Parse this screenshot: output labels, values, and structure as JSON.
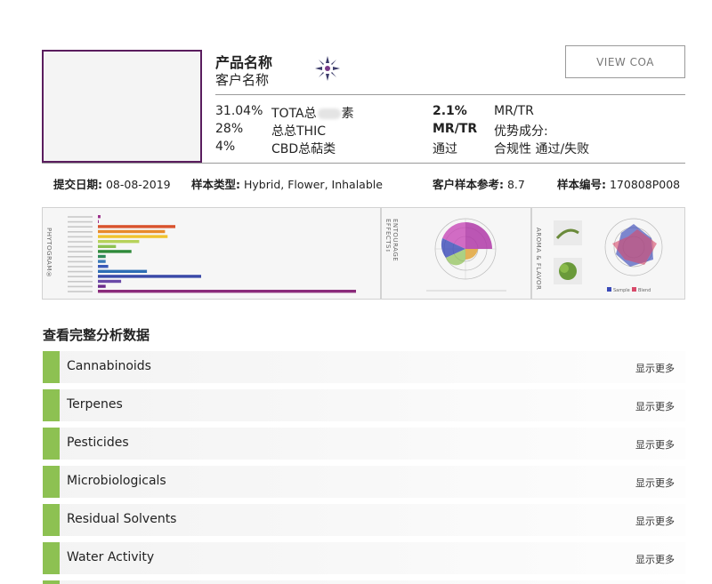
{
  "product": {
    "name": "产品名称",
    "customer": "客户名称",
    "view_coa": "VIEW COA"
  },
  "stats": {
    "left": [
      {
        "value": "31.04%",
        "label_a": "TOTA总",
        "label_b": "素"
      },
      {
        "value": "28%",
        "label": "总总THIC"
      },
      {
        "value": "4%",
        "label": "CBD总萜类"
      }
    ],
    "right": [
      {
        "key": "2.1%",
        "value": "MR/TR"
      },
      {
        "key": "MR/TR",
        "value": "优势成分:"
      },
      {
        "key": "通过",
        "value": "合规性 通过/失败"
      }
    ]
  },
  "meta": {
    "date_key": "提交日期:",
    "date_val": "08-08-2019",
    "type_key": "样本类型:",
    "type_val": "Hybrid, Flower, Inhalable",
    "ref_key": "客户样本参考:",
    "ref_val": "8.7",
    "id_key": "样本编号:",
    "id_val": "170808P008"
  },
  "panels": {
    "p1_label": "PHYTOGRAM®",
    "p2_label": "ENTOURAGE EFFECTS™",
    "p3_label": "AROMA & FLAVOR",
    "p3_legend_a": "Sample",
    "p3_legend_b": "Blend",
    "p1_bars": [
      {
        "frac": 0.01,
        "color": "#9b2f8a"
      },
      {
        "frac": 0.0,
        "color": "#9b2f8a"
      },
      {
        "frac": 0.3,
        "color": "#d9522c"
      },
      {
        "frac": 0.26,
        "color": "#e88a2c"
      },
      {
        "frac": 0.27,
        "color": "#f0c32e"
      },
      {
        "frac": 0.16,
        "color": "#b7d25a"
      },
      {
        "frac": 0.07,
        "color": "#8dc152"
      },
      {
        "frac": 0.13,
        "color": "#2f8a3a"
      },
      {
        "frac": 0.03,
        "color": "#2f8a5a"
      },
      {
        "frac": 0.03,
        "color": "#3a7ab8"
      },
      {
        "frac": 0.04,
        "color": "#3a5ab8"
      },
      {
        "frac": 0.19,
        "color": "#2e6eb5"
      },
      {
        "frac": 0.4,
        "color": "#3a4aa8"
      },
      {
        "frac": 0.09,
        "color": "#6a4aa8"
      },
      {
        "frac": 0.03,
        "color": "#6a2a8a"
      },
      {
        "frac": 1.0,
        "color": "#8a2a7a"
      }
    ]
  },
  "analysis": {
    "title": "查看完整分析数据",
    "show_more": "显示更多",
    "items": [
      {
        "label": "Cannabinoids"
      },
      {
        "label": "Terpenes"
      },
      {
        "label": "Pesticides"
      },
      {
        "label": "Microbiologicals"
      },
      {
        "label": "Residual Solvents"
      },
      {
        "label": "Water Activity"
      }
    ]
  },
  "colors": {
    "accent_purple": "#5a1d5e",
    "row_green": "#8dc152"
  }
}
